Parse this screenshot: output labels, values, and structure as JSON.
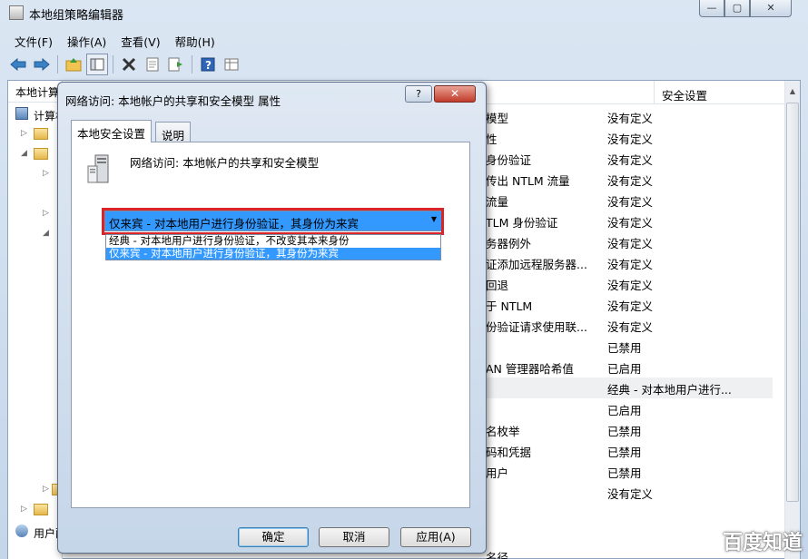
{
  "window": {
    "title": "本地组策略编辑器",
    "min": "—",
    "max": "▢",
    "close": "✕"
  },
  "menu": [
    "文件(F)",
    "操作(A)",
    "查看(V)",
    "帮助(H)"
  ],
  "tree": {
    "header": "本地计算机 策略",
    "computer_node": "计算机配置",
    "users_node": "用户配置"
  },
  "list": {
    "col_security": "安全设置",
    "rows": [
      {
        "policy": "模型",
        "setting": "没有定义"
      },
      {
        "policy": "性",
        "setting": "没有定义"
      },
      {
        "policy": "身份验证",
        "setting": "没有定义"
      },
      {
        "policy": "传出 NTLM 流量",
        "setting": "没有定义"
      },
      {
        "policy": "流量",
        "setting": "没有定义"
      },
      {
        "policy": "TLM 身份验证",
        "setting": "没有定义"
      },
      {
        "policy": "务器例外",
        "setting": "没有定义"
      },
      {
        "policy": "证添加远程服务器...",
        "setting": "没有定义"
      },
      {
        "policy": "回退",
        "setting": "没有定义"
      },
      {
        "policy": "于 NTLM",
        "setting": "没有定义"
      },
      {
        "policy": "份验证请求使用联...",
        "setting": "没有定义"
      },
      {
        "policy": "",
        "setting": "已禁用"
      },
      {
        "policy": "AN 管理器哈希值",
        "setting": "已启用"
      },
      {
        "policy": "",
        "setting": "经典 - 对本地用户进行..."
      },
      {
        "policy": "",
        "setting": "已启用"
      },
      {
        "policy": "名枚举",
        "setting": "已禁用"
      },
      {
        "policy": "码和凭据",
        "setting": "已禁用"
      },
      {
        "policy": "用户",
        "setting": "已禁用"
      },
      {
        "policy": "",
        "setting": "没有定义"
      }
    ],
    "last_row_policy": "名径"
  },
  "dialog": {
    "title": "网络访问: 本地帐户的共享和安全模型 属性",
    "help_label": "?",
    "close_label": "✕",
    "tabs": [
      "本地安全设置",
      "说明"
    ],
    "policy_name": "网络访问: 本地帐户的共享和安全模型",
    "combo_value": "仅来宾 - 对本地用户进行身份验证，其身份为来宾",
    "options": [
      "经典 - 对本地用户进行身份验证，不改变其本来身份",
      "仅来宾 - 对本地用户进行身份验证，其身份为来宾"
    ],
    "buttons": {
      "ok": "确定",
      "cancel": "取消",
      "apply": "应用(A)"
    }
  },
  "watermark": "百度知道"
}
